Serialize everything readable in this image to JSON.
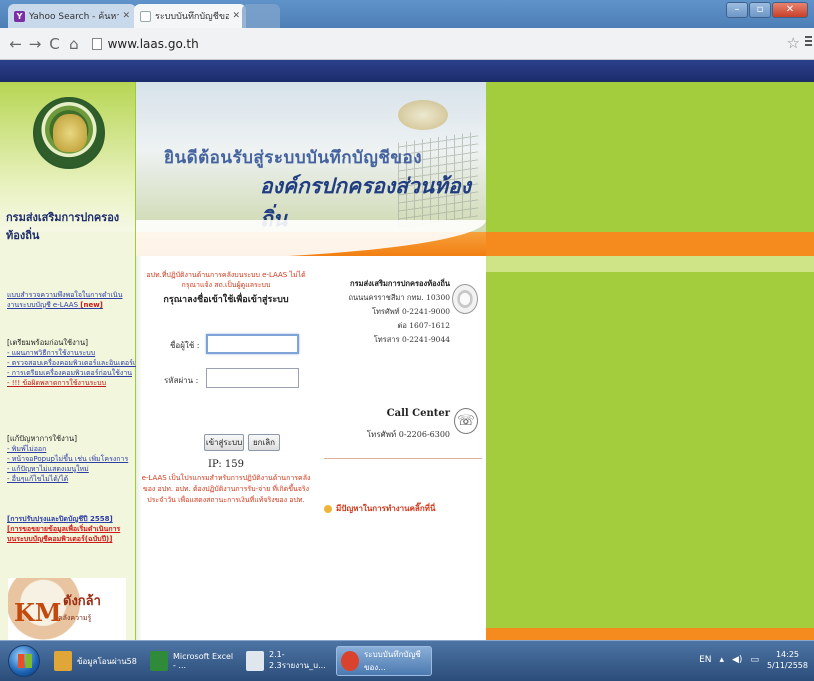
{
  "browser": {
    "tabs": [
      {
        "title": "Yahoo Search - ค้นหาเว็บ",
        "icon": "yahoo-favicon"
      },
      {
        "title": "ระบบบันทึกบัญชีขององค์กรปก",
        "icon": "page-favicon"
      }
    ],
    "url": "www.laas.go.th",
    "window_buttons": [
      "minimize",
      "maximize",
      "close"
    ]
  },
  "sidebar": {
    "org_title": "กรมส่งเสริมการปกครองท้องถิ่น",
    "survey": {
      "line1": "แบบสำรวจความพึงพอใจในการดำเนิน",
      "line2": "งานระบบบัญชี e-LAAS",
      "new_badge": "[new]"
    },
    "prepare_heading": "[เตรียมพร้อมก่อนใช้งาน]",
    "prepare_items": [
      "- แผนภาพวิธีการใช้งานระบบ",
      "- ตรวจสอบเครื่องคอมพิวเตอร์และอินเตอร์เน็ต",
      "- การเตรียมเครื่องคอมพิวเตอร์ก่อนใช้งาน",
      "- !!! ข้อผิดพลาดการใช้งานระบบ"
    ],
    "problem_heading": "[แก้ปัญหาการใช้งาน]",
    "problem_items": [
      "- พิมพ์ไม่ออก",
      "- หน้าจอPopupไม่ขึ้น เช่น เพิ่มโครงการ",
      "- แก้ปัญหาไม่แสดงเมนูใหม่",
      "- อื่นๆแก้ไขไม่ได้/ได้"
    ],
    "update_links": [
      "[การปรับปรุงและปิดบัญชีปี 2558]",
      "[การขอขยายข้อมูลเพื่อเริ่มดำเนินการ",
      "บนระบบบัญชีคอมพิวเตอร์(ฉบับปี)]"
    ],
    "km": {
      "logo": "KM",
      "sub": "ดังกล้า",
      "caption": "คลังความรู้"
    }
  },
  "banner": {
    "line1": "ยินดีต้อนรับสู่ระบบบันทึกบัญชีของ",
    "line2": "องค์กรปกครองส่วนท้องถิ่น"
  },
  "login": {
    "notice": "อปท.ที่ปฏิบัติงานด้านการคลังบนระบบ e-LAAS ไม่ได้ กรุณาแจ้ง สถ.เป็นผู้ดูแลระบบ",
    "heading": "กรุณาลงชื่อเข้าใช้เพื่อเข้าสู่ระบบ",
    "username_label": "ชื่อผู้ใช้ :",
    "username_value": "",
    "password_label": "รหัสผ่าน :",
    "password_value": "",
    "submit_label": "เข้าสู่ระบบ",
    "cancel_label": "ยกเลิก",
    "ip": "IP: 159",
    "description": "e-LAAS เป็นโปรแกรมสำหรับการปฏิบัติงานด้านการคลัง ของ อปท. อปท. ต้องปฏิบัติงานการรับ-จ่าย ที่เกิดขึ้นจริงประจำวัน เพื่อแสดงสถานะการเงินที่แท้จริงของ อปท."
  },
  "contact": {
    "org": "กรมส่งเสริมการปกครองท้องถิ่น",
    "address": "ถนนนครราชสีมา กทม. 10300",
    "phone": "โทรศัพท์ 0-2241-9000",
    "ext": "ต่อ 1607-1612",
    "fax": "โทรสาร 0-2241-9044",
    "cc_title": "Call Center",
    "cc_phone": "โทรศัพท์ 0-2206-6300",
    "help_link": "มีปัญหาในการทำงานคลิ๊กที่นี่"
  },
  "taskbar": {
    "items": [
      {
        "label": "ข้อมูลโอนผ่าน58",
        "icon": "folder-icon",
        "color": "#e0a638"
      },
      {
        "label": "Microsoft Excel - ...",
        "icon": "excel-icon",
        "color": "#2f8a3a"
      },
      {
        "label": "2.1-2.3รายงาน_u...",
        "icon": "document-icon",
        "color": "#dfe6ee"
      },
      {
        "label": "ระบบบันทึกบัญชีของ...",
        "icon": "chrome-icon",
        "color": "#d9432e"
      }
    ],
    "lang": "EN",
    "time": "14:25",
    "date": "5/11/2558"
  },
  "colors": {
    "green": "#9fcb3a",
    "orange": "#f58a1f",
    "navy": "#1c2c6a"
  }
}
